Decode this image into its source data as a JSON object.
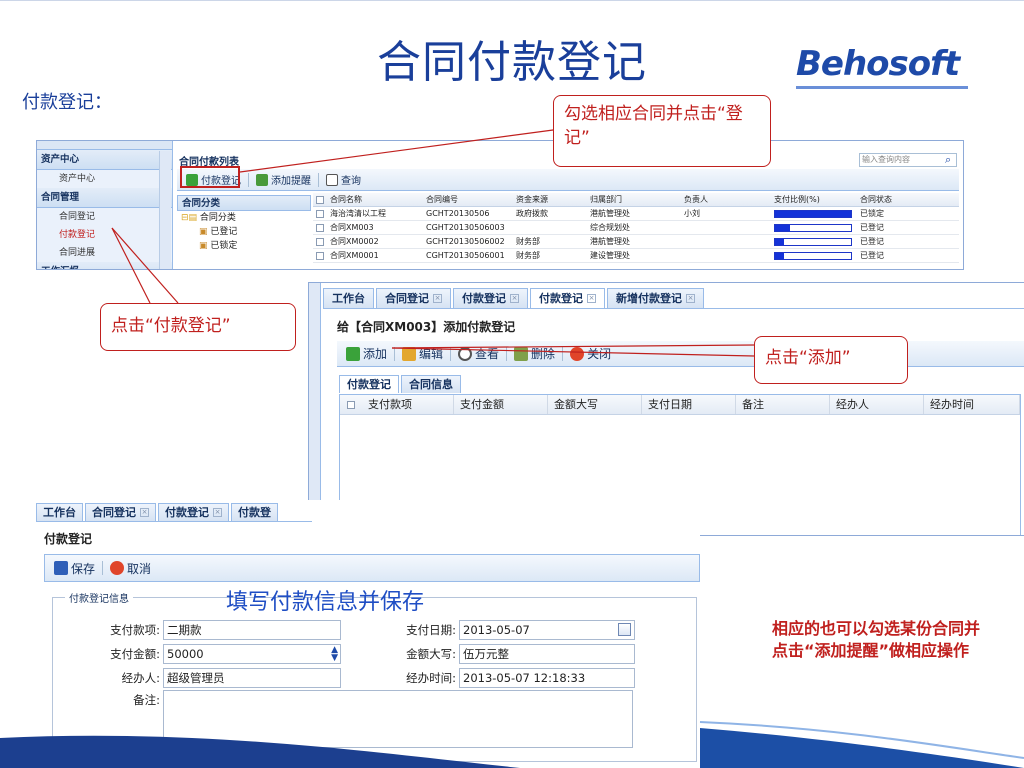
{
  "slide": {
    "title": "合同付款登记",
    "logo": "Behosoft",
    "section_label": "付款登记："
  },
  "callouts": {
    "select_contract": "勾选相应合同并点击“登记”",
    "click_register": "点击“付款登记”",
    "click_add": "点击“添加”",
    "fill_and_save": "填写付款信息并保存",
    "note": "相应的也可以勾选某份合同并点击“添加提醒”做相应操作"
  },
  "list_window": {
    "nav": [
      {
        "type": "head",
        "label": "资产中心"
      },
      {
        "type": "sub",
        "label": "资产中心"
      },
      {
        "type": "head",
        "label": "合同管理"
      },
      {
        "type": "sub",
        "label": "合同登记"
      },
      {
        "type": "sub",
        "label": "付款登记",
        "active": true
      },
      {
        "type": "sub",
        "label": "合同进展"
      },
      {
        "type": "head",
        "label": "工作汇报"
      }
    ],
    "main_title": "合同付款列表",
    "toolbar": {
      "pay_register": "付款登记",
      "add_reminder": "添加提醒",
      "query": "查询"
    },
    "search_placeholder": "输入查询内容",
    "tree": {
      "head": "合同分类",
      "items": [
        "合同分类",
        "已登记",
        "已锁定"
      ]
    },
    "columns": [
      "合同名称",
      "合同编号",
      "资金来源",
      "归属部门",
      "负责人",
      "支付比例(%)",
      "合同状态"
    ],
    "rows": [
      {
        "name": "海治湾清以工程",
        "code": "GCHT20130506",
        "fund": "政府拨款",
        "dept": "港航管理处",
        "owner": "小刘",
        "ratio": 1.0,
        "status": "已锁定"
      },
      {
        "name": "合同XM003",
        "code": "CGHT20130506003",
        "fund": "",
        "dept": "综合规划处",
        "owner": "",
        "ratio": 0.2,
        "status": "已登记"
      },
      {
        "name": "合同XM0002",
        "code": "GCHT20130506002",
        "fund": "财务部",
        "dept": "港航管理处",
        "owner": "",
        "ratio": 0.12,
        "status": "已登记"
      },
      {
        "name": "合同XM0001",
        "code": "CGHT20130506001",
        "fund": "财务部",
        "dept": "建设管理处",
        "owner": "",
        "ratio": 0.12,
        "status": "已登记"
      }
    ]
  },
  "add_window": {
    "tabs": [
      "工作台",
      "合同登记",
      "付款登记",
      "付款登记",
      "新增付款登记"
    ],
    "title": "给【合同XM003】添加付款登记",
    "toolbar": {
      "add": "添加",
      "edit": "编辑",
      "view": "查看",
      "delete": "删除",
      "close": "关闭"
    },
    "subtabs": [
      "付款登记",
      "合同信息"
    ],
    "columns": [
      "支付款项",
      "支付金额",
      "金额大写",
      "支付日期",
      "备注",
      "经办人",
      "经办时间"
    ]
  },
  "form_window": {
    "tabs": [
      "工作台",
      "合同登记",
      "付款登记",
      "付款登"
    ],
    "title": "付款登记",
    "toolbar": {
      "save": "保存",
      "cancel": "取消"
    },
    "legend": "付款登记信息",
    "fields": {
      "pay_item_label": "支付款项:",
      "pay_item": "二期款",
      "pay_amount_label": "支付金额:",
      "pay_amount": "50000",
      "handler_label": "经办人:",
      "handler": "超级管理员",
      "note_label": "备注:",
      "pay_date_label": "支付日期:",
      "pay_date": "2013-05-07",
      "amount_cn_label": "金额大写:",
      "amount_cn": "伍万元整",
      "handle_time_label": "经办时间:",
      "handle_time": "2013-05-07 12:18:33"
    }
  },
  "colors": {
    "accent": "#1a3f9a",
    "callout": "#c0201e",
    "progress": "#1432d8"
  }
}
